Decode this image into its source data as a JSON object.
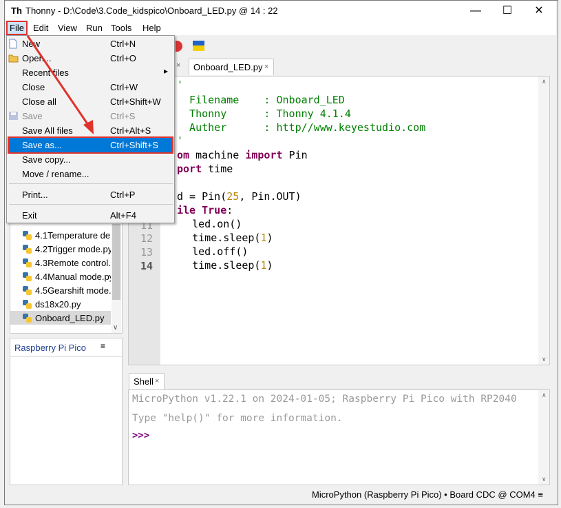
{
  "window": {
    "app_name": "Thonny",
    "title": "Thonny  -  D:\\Code\\3.Code_kidspico\\Onboard_LED.py  @  14 : 22",
    "minimize": "—",
    "maximize": "☐",
    "close": "✕"
  },
  "menubar": [
    "File",
    "Edit",
    "View",
    "Run",
    "Tools",
    "Help"
  ],
  "file_menu": [
    {
      "label": "New",
      "shortcut": "Ctrl+N"
    },
    {
      "label": "Open...",
      "shortcut": "Ctrl+O"
    },
    {
      "label": "Recent files",
      "shortcut": "▸"
    },
    {
      "label": "Close",
      "shortcut": "Ctrl+W"
    },
    {
      "label": "Close all",
      "shortcut": "Ctrl+Shift+W"
    },
    {
      "label": "Save",
      "shortcut": "Ctrl+S",
      "disabled": true
    },
    {
      "label": "Save All files",
      "shortcut": "Ctrl+Alt+S"
    },
    {
      "label": "Save as...",
      "shortcut": "Ctrl+Shift+S",
      "highlighted": true
    },
    {
      "label": "Save copy..."
    },
    {
      "label": "Move / rename..."
    },
    {
      "label": "Print...",
      "shortcut": "Ctrl+P"
    },
    {
      "label": "Exit",
      "shortcut": "Alt+F4"
    }
  ],
  "editor": {
    "tab_label": "Onboard_LED.py",
    "tab_close": "×",
    "partial_tab_close": "×",
    "code_lines": [
      {
        "n": "",
        "text": "'"
      },
      {
        "n": "",
        "text": "  Filename    : Onboard_LED"
      },
      {
        "n": "",
        "text": "  Thonny      : Thonny 4.1.4"
      },
      {
        "n": "",
        "text": "  Auther      : http//www.keyestudio.com"
      },
      {
        "n": "",
        "text": "'"
      },
      {
        "n": "",
        "text": "om machine import Pin"
      },
      {
        "n": "",
        "text": "port time"
      },
      {
        "n": "",
        "text": ""
      },
      {
        "n": "",
        "text": "d = Pin(25, Pin.OUT)"
      },
      {
        "n": "",
        "text": "ile True:"
      },
      {
        "n": "11",
        "text": "    led.on()"
      },
      {
        "n": "12",
        "text": "    time.sleep(1)"
      },
      {
        "n": "13",
        "text": "    led.off()"
      },
      {
        "n": "14",
        "text": "    time.sleep(1)"
      }
    ]
  },
  "files": {
    "items": [
      "4.1Temperature de",
      "4.2Trigger mode.py",
      "4.3Remote control.",
      "4.4Manual mode.py",
      "4.5Gearshift mode.",
      "ds18x20.py",
      "Onboard_LED.py"
    ],
    "selected": "Onboard_LED.py",
    "partial_row": "....py"
  },
  "pico_panel": {
    "title": "Raspberry Pi Pico",
    "menu_icon": "≡"
  },
  "shell": {
    "tab_label": "Shell",
    "tab_close": "×",
    "line1": "MicroPython v1.22.1 on 2024-01-05; Raspberry Pi Pico with RP2040",
    "line2": "Type \"help()\" for more information.",
    "prompt": ">>>"
  },
  "status": "MicroPython (Raspberry Pi Pico)  •  Board CDC @ COM4  ≡",
  "colors": {
    "highlight": "#0078d7",
    "annotation": "#e0332b",
    "keyword": "#7f0055",
    "string": "#007f00",
    "number": "#b8860b"
  }
}
